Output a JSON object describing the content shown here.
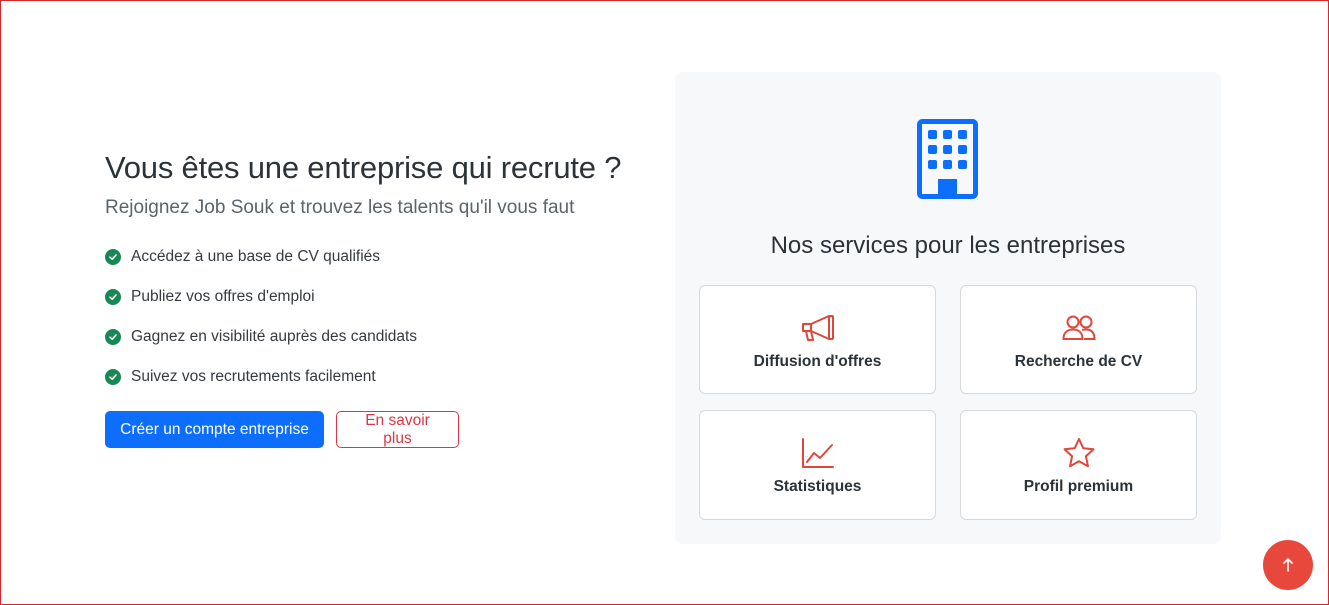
{
  "hero": {
    "title": "Vous êtes une entreprise qui recrute ?",
    "subtitle": "Rejoignez Job Souk et trouvez les talents qu'il vous faut",
    "features": [
      "Accédez à une base de CV qualifiés",
      "Publiez vos offres d'emploi",
      "Gagnez en visibilité auprès des candidats",
      "Suivez vos recrutements facilement"
    ],
    "primary_button": "Créer un compte entreprise",
    "secondary_button": "En savoir plus"
  },
  "services": {
    "icon": "building-icon",
    "title": "Nos services pour les entreprises",
    "cards": [
      {
        "label": "Diffusion d'offres",
        "icon": "megaphone-icon"
      },
      {
        "label": "Recherche de CV",
        "icon": "people-icon"
      },
      {
        "label": "Statistiques",
        "icon": "graph-up-icon"
      },
      {
        "label": "Profil premium",
        "icon": "star-icon"
      }
    ]
  },
  "scroll_top": {
    "icon": "arrow-up-icon"
  },
  "colors": {
    "primary": "#0d6efd",
    "danger": "#dc3545",
    "success": "#198754",
    "accent": "#e8473b",
    "panel_bg": "#f7f8f9"
  }
}
